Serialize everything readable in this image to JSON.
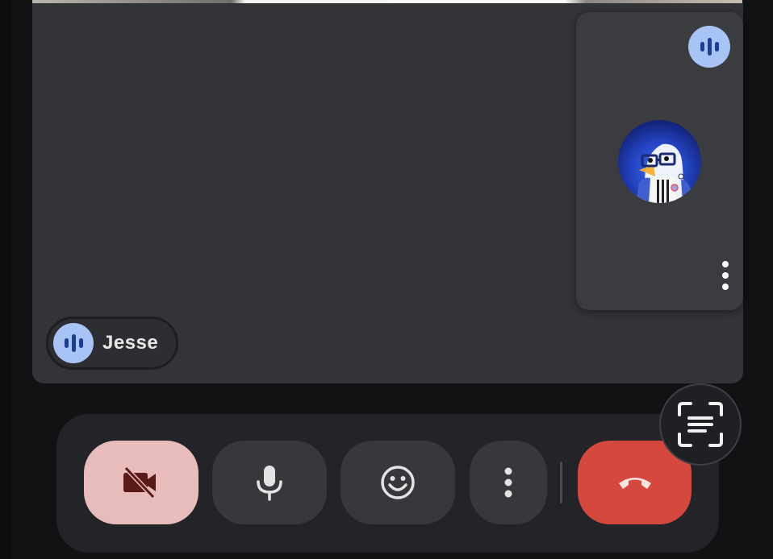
{
  "participant": {
    "name": "Jesse",
    "speaking_icon": "audio-level-bars-icon"
  },
  "self_tile": {
    "speaking_icon": "audio-level-bars-icon",
    "avatar_icon": "penguin-with-glasses-avatar",
    "menu_icon": "more-vertical-icon"
  },
  "controls": {
    "camera_icon": "video-off-icon",
    "mic_icon": "microphone-icon",
    "reactions_icon": "emoji-icon",
    "more_icon": "more-vertical-icon",
    "hangup_icon": "hang-up-phone-icon",
    "capture_icon": "screen-scan-icon"
  },
  "colors": {
    "speaking_badge": "#a8c3f5",
    "camera_off_bg": "#e7bcbb",
    "hangup_bg": "#d4483d",
    "tile_bg": "#333437",
    "control_bar_bg": "#232427"
  }
}
